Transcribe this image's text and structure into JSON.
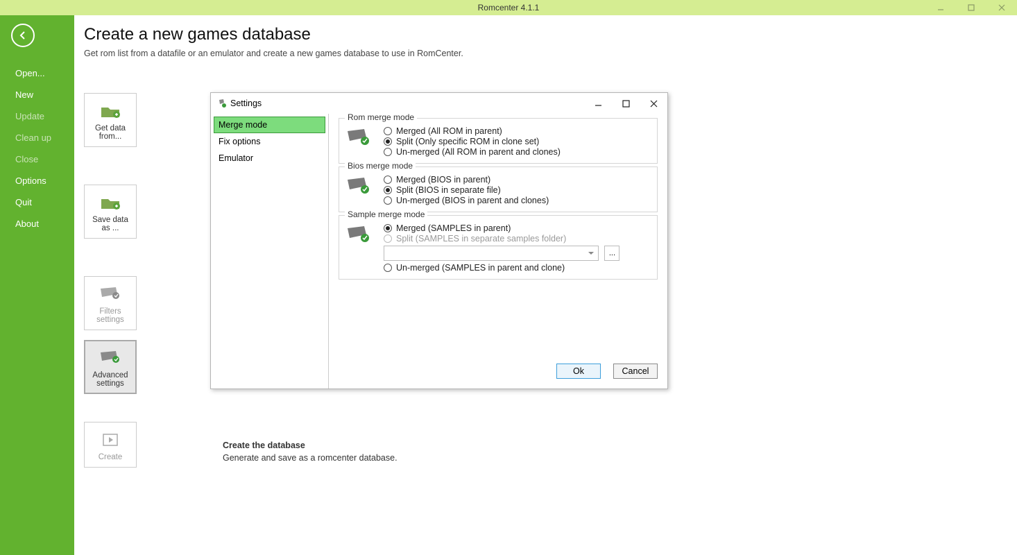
{
  "titlebar": {
    "title": "Romcenter 4.1.1"
  },
  "sidebar": {
    "items": [
      {
        "label": "Open...",
        "disabled": false
      },
      {
        "label": "New",
        "disabled": false
      },
      {
        "label": "Update",
        "disabled": true
      },
      {
        "label": "Clean up",
        "disabled": true
      },
      {
        "label": "Close",
        "disabled": true
      },
      {
        "label": "Options",
        "disabled": false
      },
      {
        "label": "Quit",
        "disabled": false
      },
      {
        "label": "About",
        "disabled": false
      }
    ]
  },
  "page": {
    "title": "Create a new games database",
    "subtitle": "Get rom list from a datafile or an emulator and create a new games database to use in RomCenter."
  },
  "tiles": {
    "get_data": {
      "label1": "Get data",
      "label2": "from..."
    },
    "save_data": {
      "label1": "Save data",
      "label2": "as ..."
    },
    "filters": {
      "label1": "Filters",
      "label2": "settings"
    },
    "advanced": {
      "label1": "Advanced",
      "label2": "settings"
    },
    "create": {
      "label1": "Create"
    }
  },
  "create_section": {
    "title": "Create the database",
    "desc": "Generate and save as a romcenter database."
  },
  "dialog": {
    "title": "Settings",
    "nav": {
      "merge": "Merge mode",
      "fix": "Fix options",
      "emulator": "Emulator"
    },
    "rom": {
      "legend": "Rom merge mode",
      "merged": "Merged (All ROM in parent)",
      "split": "Split (Only specific ROM in clone set)",
      "unmerged": "Un-merged (All ROM in parent and clones)",
      "selected": "split"
    },
    "bios": {
      "legend": "Bios merge mode",
      "merged": "Merged (BIOS in parent)",
      "split": "Split (BIOS in separate file)",
      "unmerged": "Un-merged (BIOS in parent and clones)",
      "selected": "split"
    },
    "sample": {
      "legend": "Sample merge mode",
      "merged": "Merged (SAMPLES in parent)",
      "split": "Split (SAMPLES in separate samples folder)",
      "unmerged": "Un-merged (SAMPLES in parent and clone)",
      "selected": "merged",
      "folder": "",
      "browse": "..."
    },
    "buttons": {
      "ok": "Ok",
      "cancel": "Cancel"
    }
  }
}
